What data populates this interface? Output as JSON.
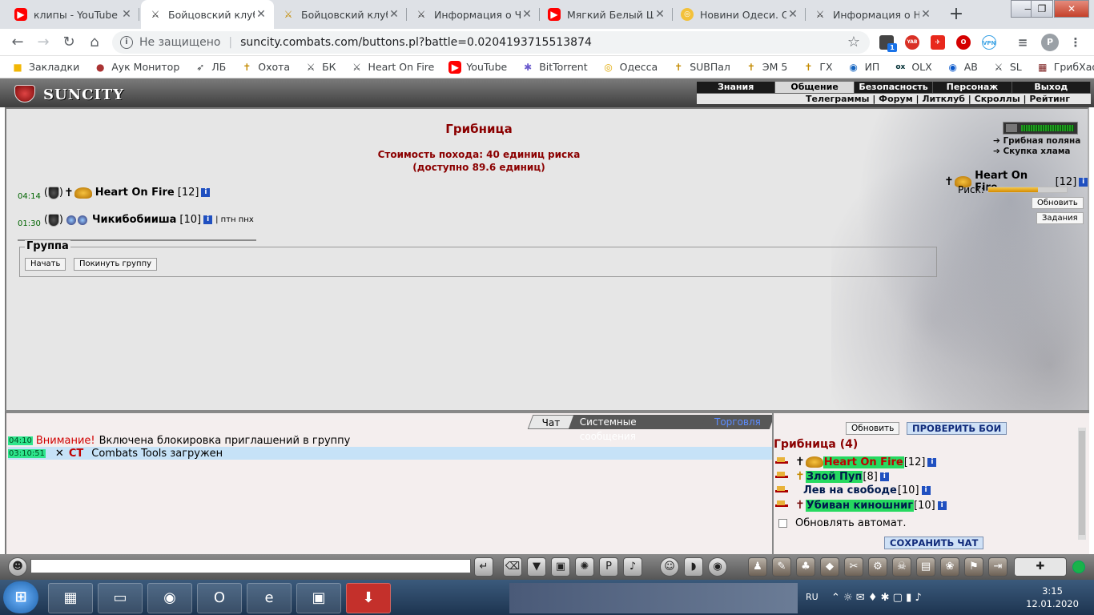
{
  "browser": {
    "tabs": [
      {
        "title": "клипы - YouTube",
        "icon": "youtube-icon"
      },
      {
        "title": "Бойцовский клуб",
        "icon": "crossed-swords-icon",
        "active": true
      },
      {
        "title": "Бойцовский клуб.",
        "icon": "gold-swords-icon"
      },
      {
        "title": "Информация о Чи",
        "icon": "crossed-swords-icon"
      },
      {
        "title": "Мягкий Белый Шу",
        "icon": "youtube-icon"
      },
      {
        "title": "Новини Одеси. Ос",
        "icon": "news-icon"
      },
      {
        "title": "Информация о Не",
        "icon": "crossed-swords-icon"
      }
    ],
    "insecure_label": "Не защищено",
    "url": "suncity.combats.com/buttons.pl?battle=0.0204193715513874",
    "profile_initial": "P",
    "ext_badge": "1",
    "ext_yab": "YAB",
    "bookmarks": [
      "Закладки",
      "Аук Монитор",
      "ЛБ",
      "Охота",
      "БК",
      "Heart On Fire",
      "YouTube",
      "BitTorrent",
      "Одесса",
      "SUBПал",
      "ЭМ 5",
      "ГХ",
      "ИП",
      "OLX",
      "АВ",
      "SL",
      "ГрибХаоса"
    ]
  },
  "game": {
    "logo": "SUNCITY",
    "top_menu": [
      "Знания",
      "Общение",
      "Безопасность",
      "Персонаж",
      "Выход"
    ],
    "active_menu": "Общение",
    "sub_menu": "Телеграммы | Форум | Литклуб | Скроллы | Рейтинг",
    "location_title": "Грибница",
    "cost_line": "Стоимость похода: 40 единиц риска",
    "available_line": "(доступно 89.6 единиц)",
    "players": [
      {
        "time": "04:14",
        "name": "Heart On Fire",
        "level": "[12]",
        "note": ""
      },
      {
        "time": "01:30",
        "name": "Чикибобииша",
        "level": "[10]",
        "note": "| птн пнх"
      }
    ],
    "group_legend": "Группа",
    "start_btn": "Начать",
    "leave_btn": "Покинуть группу",
    "side_links": [
      "Грибная поляна",
      "Скупка хлама"
    ],
    "self_name": "Heart On Fire",
    "self_level": "[12]",
    "risk_label": "Риск:",
    "risk_fraction": 0.63,
    "refresh_btn": "Обновить",
    "tasks_btn": "Задания"
  },
  "chat": {
    "tabs": [
      "Чат",
      "Системные сообщения",
      "Торговля"
    ],
    "messages": [
      {
        "time": "04:10",
        "warn": "Внимание!",
        "text": "Включена блокировка приглашений в группу"
      },
      {
        "time": "03:10:51",
        "tag": "CT",
        "text": "Combats Tools загружен",
        "close": "✕"
      }
    ]
  },
  "panel": {
    "refresh_btn": "Обновить",
    "check_btn": "ПРОВЕРИТЬ БОИ",
    "title": "Грибница (4)",
    "members": [
      {
        "name": "Heart On Fire",
        "level": "[12]",
        "highlight": true
      },
      {
        "name": "Злой Пуп",
        "level": "[8]",
        "highlight": true
      },
      {
        "name": "Лев на свободе",
        "level": "[10]",
        "highlight": false
      },
      {
        "name": "Убиван киношниг",
        "level": "[10]",
        "highlight": true
      }
    ],
    "auto_label": "Обновлять автомат.",
    "save_btn": "СОХРАНИТЬ ЧАТ"
  },
  "taskbar": {
    "lang": "RU",
    "time": "3:15",
    "date": "12.01.2020"
  }
}
